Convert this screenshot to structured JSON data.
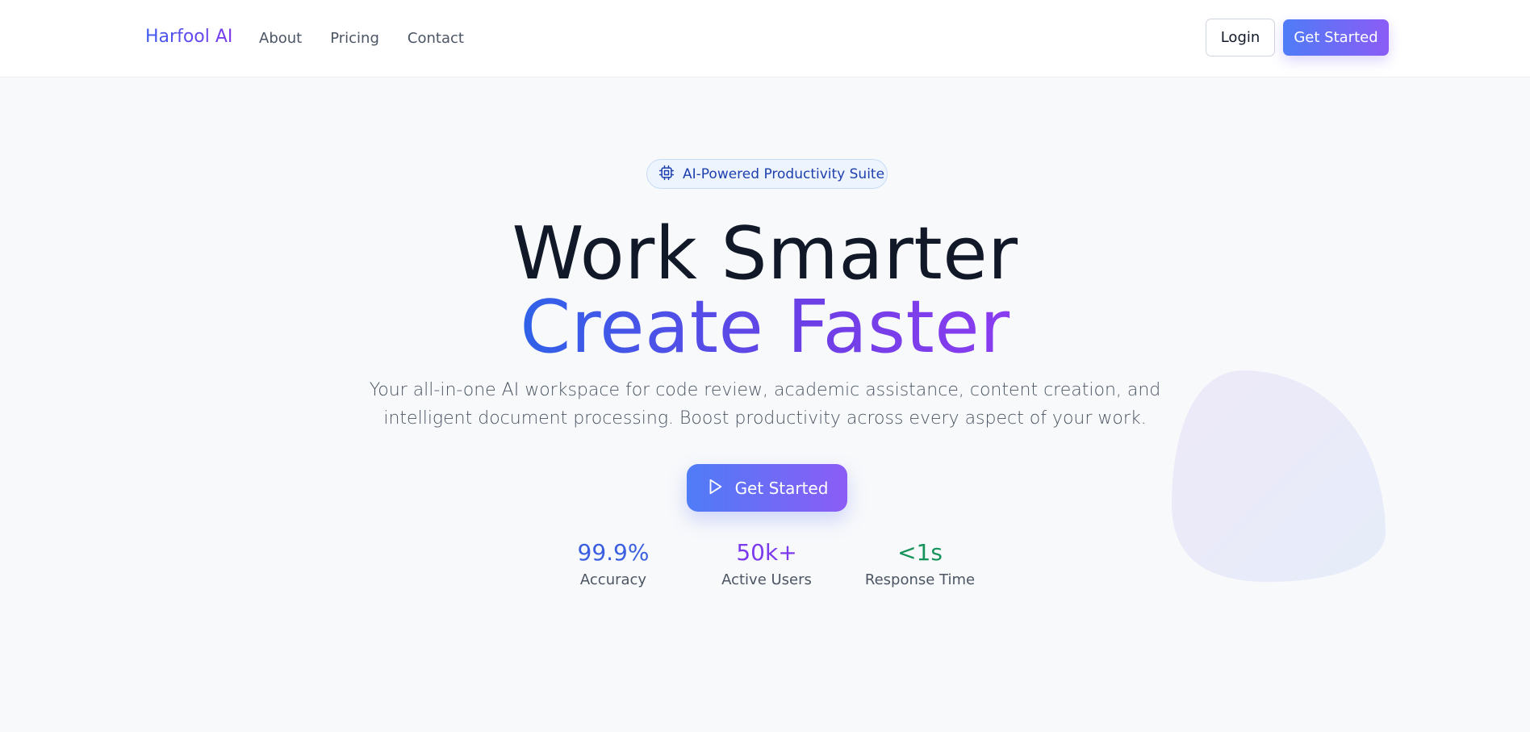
{
  "header": {
    "brand": "Harfool AI",
    "nav": [
      "About",
      "Pricing",
      "Contact"
    ],
    "login_label": "Login",
    "cta_label": "Get Started"
  },
  "hero": {
    "badge": {
      "icon": "cpu-chip-icon",
      "text": "AI-Powered Productivity Suite"
    },
    "title_line1": "Work Smarter",
    "title_line2": "Create Faster",
    "subtitle": "Your all-in-one AI workspace for code review, academic assistance, content creation, and intelligent document processing. Boost productivity across every aspect of your work.",
    "cta": {
      "icon": "play-icon",
      "label": "Get Started"
    },
    "stats": [
      {
        "value": "99.9%",
        "label": "Accuracy",
        "color": "#3b5fe0"
      },
      {
        "value": "50k+",
        "label": "Active Users",
        "color": "#7c3aed"
      },
      {
        "value": "<1s",
        "label": "Response Time",
        "color": "#15935b"
      }
    ]
  },
  "colors": {
    "brand_gradient_start": "#3f5bf0",
    "brand_gradient_end": "#8b5cf6",
    "badge_text": "#1e40af",
    "page_background": "#f8f9fb"
  }
}
